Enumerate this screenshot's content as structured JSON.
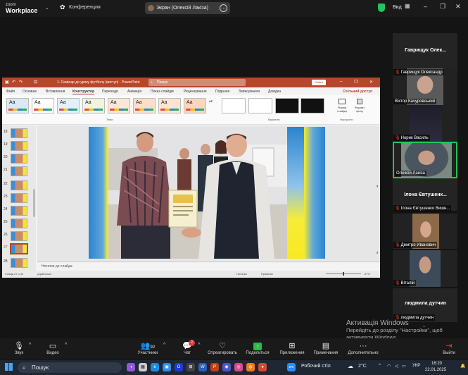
{
  "zoom": {
    "logo_line1": "zoom",
    "logo_line2": "Workplace",
    "conference_label": "Конференция",
    "screen_share_label": "Экран (Олексій Лакіза)",
    "view_label": "Вид"
  },
  "ppt": {
    "doc_title": "1. Семінар до уроку футболу (виступ) - PowerPoint",
    "search_placeholder": "Пошук",
    "signin_label": "Увійти",
    "tabs": [
      "Файл",
      "Основне",
      "Вставлення",
      "Конструктор",
      "Переходи",
      "Анімація",
      "Показ слайдів",
      "Рецензування",
      "Подання",
      "Записування",
      "Довідка"
    ],
    "active_tab": "Конструктор",
    "share_label": "Спільний доступ",
    "themes_label": "Теми",
    "variants_label": "Варіанти",
    "settings_label": "Настроїти",
    "slide_size_label": "Розмір слайда",
    "bg_format_label": "Формат фону",
    "theme_glyph": "Aa",
    "slide_numbers": [
      "18",
      "19",
      "20",
      "21",
      "22",
      "23",
      "24",
      "25",
      "26",
      "27",
      "28"
    ],
    "selected_slide": "27",
    "notes_placeholder": "Нотатки до слайда",
    "status_slide": "Слайд 27 з 44",
    "status_lang": "українська",
    "status_notes": "Нотатки",
    "status_comments": "Примітки",
    "zoom_level": "67%"
  },
  "participants": {
    "big_names": [
      "Гаврищук Олек...",
      "Ілона Євтушенк...",
      "людмила дутчин"
    ],
    "tiles": [
      {
        "label": "Гаврищук Олександр"
      },
      {
        "label": "Віктор Качуровський"
      },
      {
        "label": "Норик Василь"
      },
      {
        "label": "Олексій Лакіза"
      },
      {
        "label": "Ілона Євтушенко Вишн..."
      },
      {
        "label": "Дмитро Иванович"
      },
      {
        "label": "Віталій"
      },
      {
        "label": "людмила дутчин"
      }
    ]
  },
  "watermark": {
    "title": "Активація Windows",
    "line1": "Перейдіть до розділу \"Настройки\", щоб",
    "line2": "активувати Windows."
  },
  "toolbar": {
    "audio": "Звук",
    "video": "Видео",
    "participants": "Участники",
    "participants_count": "92",
    "chat": "Чат",
    "chat_badge": "2",
    "react": "Отреагировать",
    "share": "Поделиться",
    "apps": "Приложения",
    "notes": "Примечания",
    "more": "Дополнительно",
    "leave": "Выйти"
  },
  "taskbar": {
    "search": "Пошук",
    "desktop": "Робочий стіл",
    "weather": "2°C",
    "lang": "УКР",
    "time": "16:20",
    "date": "22.01.2025"
  },
  "colors": {
    "ppt_accent": "#b7472a",
    "zoom_active_border": "#22c55e",
    "leave_red": "#e23b3b"
  }
}
